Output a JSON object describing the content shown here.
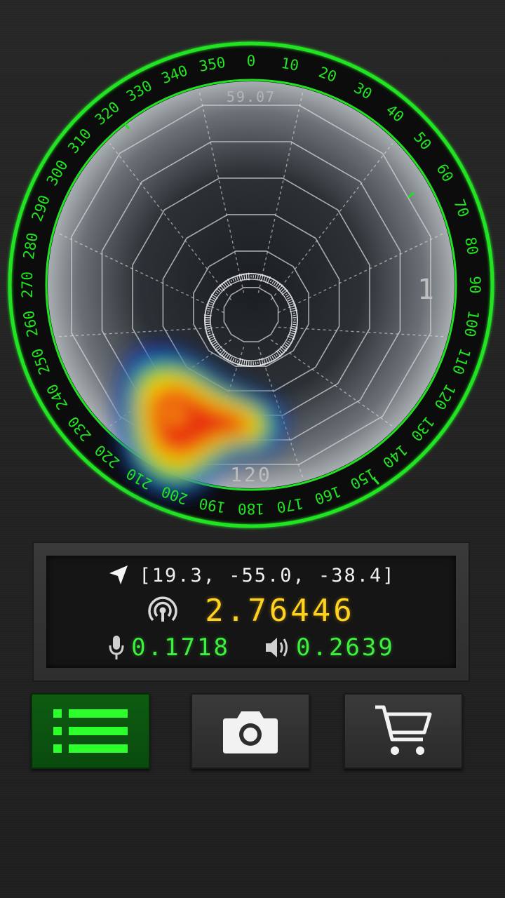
{
  "radar": {
    "compass_labels": [
      "0",
      "10",
      "20",
      "30",
      "40",
      "50",
      "60",
      "70",
      "80",
      "90",
      "100",
      "110",
      "120",
      "130",
      "140",
      "150",
      "160",
      "170",
      "180",
      "190",
      "200",
      "210",
      "220",
      "230",
      "240",
      "250",
      "260",
      "270",
      "280",
      "290",
      "300",
      "310",
      "320",
      "330",
      "340",
      "350"
    ],
    "top_value": "59.07",
    "bottom_value": "120",
    "right_value": "1",
    "ring_color": "#22e322",
    "heat_colors": [
      "#1530c8",
      "#1ec81e",
      "#ffd700",
      "#e83010"
    ]
  },
  "readout": {
    "position": "[19.3, -55.0, -38.4]",
    "signal": "2.76446",
    "mic_level": "0.1718",
    "speaker_level": "0.2639",
    "icons": {
      "position": "navigation-arrow-icon",
      "signal": "broadcast-signal-icon",
      "mic": "microphone-icon",
      "speaker": "speaker-icon"
    }
  },
  "buttons": {
    "menu_icon": "list-icon",
    "camera_icon": "camera-icon",
    "cart_icon": "shopping-cart-icon"
  }
}
